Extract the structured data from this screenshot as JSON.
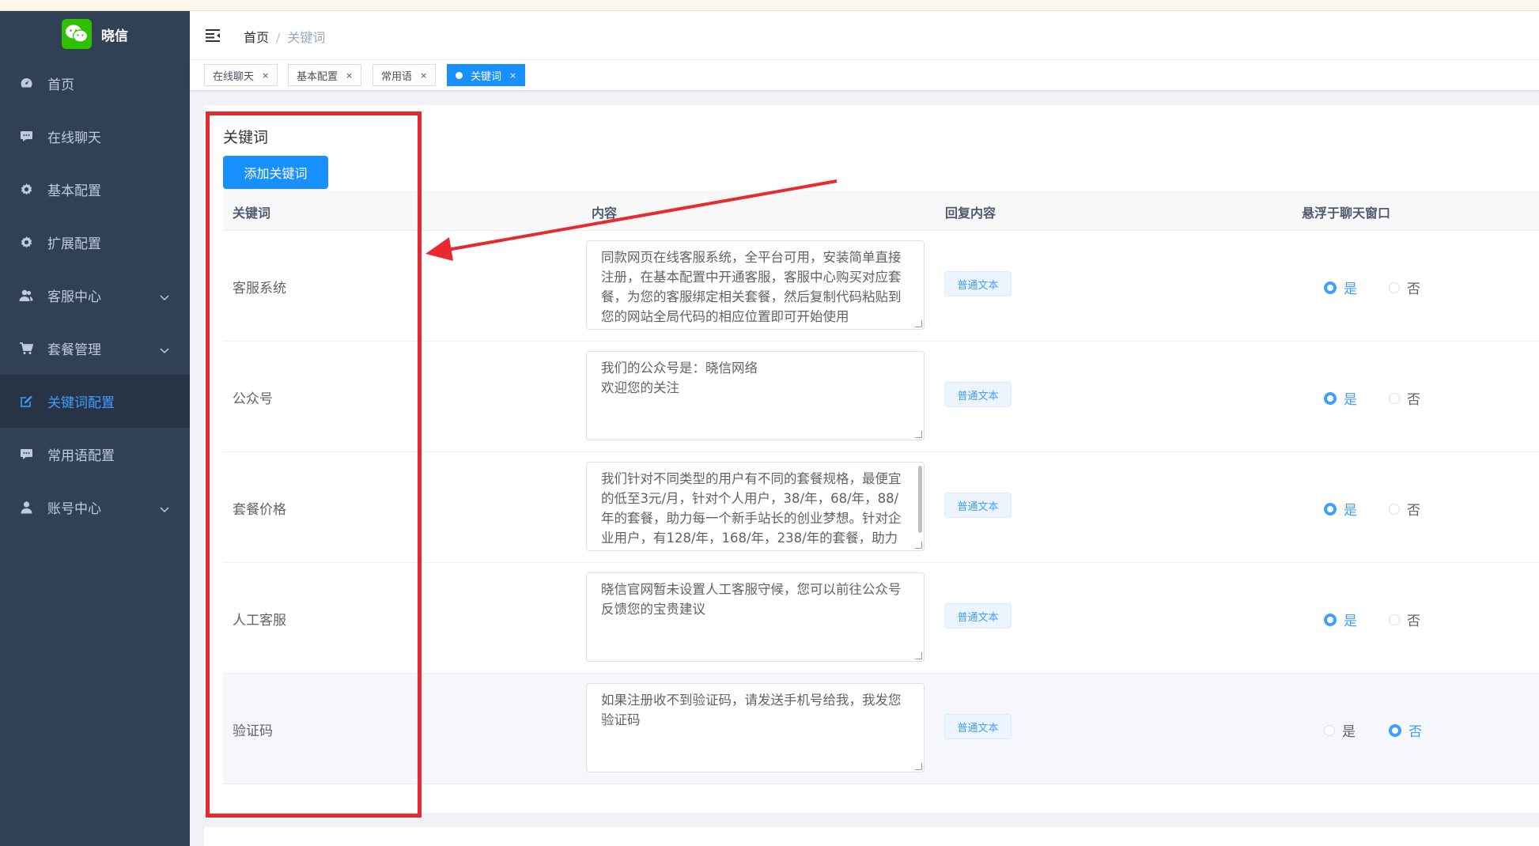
{
  "app": {
    "title": "晓信",
    "logo_icon": "wechat-icon",
    "accent": "#1890ff",
    "sidebar_bg": "#304156",
    "active_menu_color": "#409eff"
  },
  "sidebar": {
    "items": [
      {
        "label": "首页",
        "icon": "dashboard-icon"
      },
      {
        "label": "在线聊天",
        "icon": "chat-bubble-icon"
      },
      {
        "label": "基本配置",
        "icon": "gear-icon"
      },
      {
        "label": "扩展配置",
        "icon": "gear-icon"
      },
      {
        "label": "客服中心",
        "icon": "users-icon",
        "expandable": true
      },
      {
        "label": "套餐管理",
        "icon": "cart-icon",
        "expandable": true
      },
      {
        "label": "关键词配置",
        "icon": "edit-icon",
        "active": true
      },
      {
        "label": "常用语配置",
        "icon": "chat-bubble-icon"
      },
      {
        "label": "账号中心",
        "icon": "user-icon",
        "expandable": true
      }
    ]
  },
  "header": {
    "breadcrumb_home": "首页",
    "breadcrumb_sep": "/",
    "breadcrumb_current": "关键词"
  },
  "tags": [
    {
      "label": "在线聊天",
      "close": "×"
    },
    {
      "label": "基本配置",
      "close": "×"
    },
    {
      "label": "常用语",
      "close": "×"
    },
    {
      "label": "关键词",
      "close": "×",
      "active": true
    }
  ],
  "main": {
    "title": "关键词",
    "add_button": "添加关键词",
    "columns": {
      "keyword": "关键词",
      "content": "内容",
      "reply": "回复内容",
      "float": "悬浮于聊天窗口"
    },
    "radio_yes": "是",
    "radio_no": "否",
    "rows": [
      {
        "keyword": "客服系统",
        "content": "同款网页在线客服系统，全平台可用，安装简单直接注册，在基本配置中开通客服，客服中心购买对应套餐，为您的客服绑定相关套餐，然后复制代码粘贴到您的网站全局代码的相应位置即可开始使用",
        "reply_type": "普通文本",
        "float": "yes"
      },
      {
        "keyword": "公众号",
        "content": "我们的公众号是：晓信网络\n欢迎您的关注",
        "reply_type": "普通文本",
        "float": "yes"
      },
      {
        "keyword": "套餐价格",
        "content": "我们针对不同类型的用户有不同的套餐规格，最便宜的低至3元/月，针对个人用户，38/年，68/年，88/年的套餐，助力每一个新手站长的创业梦想。针对企业用户，有128/年，168/年，238/年的套餐，助力每一个企业的正面形象",
        "reply_type": "普通文本",
        "float": "yes"
      },
      {
        "keyword": "人工客服",
        "content": "晓信官网暂未设置人工客服守候，您可以前往公众号反馈您的宝贵建议",
        "reply_type": "普通文本",
        "float": "yes"
      },
      {
        "keyword": "验证码",
        "content": "如果注册收不到验证码，请发送手机号给我，我发您验证码",
        "reply_type": "普通文本",
        "float": "no"
      }
    ]
  },
  "annotation": {
    "color": "#e8292f",
    "shape": "red-rectangle-with-arrow"
  }
}
